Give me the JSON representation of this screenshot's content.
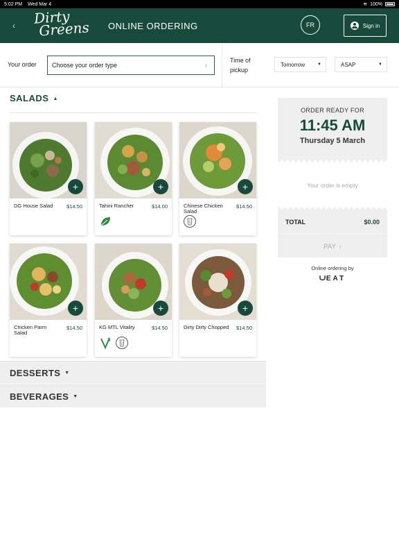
{
  "status": {
    "time": "5:02 PM",
    "date": "Wed Mar 4",
    "battery": "100%"
  },
  "header": {
    "logo_line1": "Dirty",
    "logo_line2": "Greens",
    "title": "ONLINE ORDERING",
    "lang": "FR",
    "signin": "Sign in"
  },
  "order": {
    "your_order_label": "Your order",
    "order_type_placeholder": "Choose your order type",
    "time_label": "Time of pickup",
    "day": "Tomorrow",
    "time": "ASAP"
  },
  "menu": {
    "salads_title": "SALADS",
    "items": [
      {
        "name": "DG House Salad",
        "price": "$14.50"
      },
      {
        "name": "Tahini Rancher",
        "price": "$14.00"
      },
      {
        "name": "Chinese Chicken Salad",
        "price": "$14.50"
      },
      {
        "name": "Chicken Parm Salad",
        "price": "$14.50"
      },
      {
        "name": "KG MTL Vitality",
        "price": "$14.50"
      },
      {
        "name": "Dirty Dirty Chopped",
        "price": "$14.50"
      }
    ],
    "desserts_title": "DESSERTS",
    "beverages_title": "BEVERAGES"
  },
  "cart": {
    "ready_label": "ORDER READY FOR",
    "ready_time": "11:45 AM",
    "ready_date": "Thursday 5 March",
    "empty_text": "Your order is empty",
    "total_label": "TOTAL",
    "total_value": "$0.00",
    "pay_label": "PAY",
    "byline": "Online ordering by",
    "brand": "EAT"
  },
  "colors": {
    "brand_green": "#174a3a",
    "panel_gray": "#efefef"
  },
  "icons": [
    "back-chevron-icon",
    "user-icon",
    "caret-down-icon",
    "plus-icon",
    "leaf-icon",
    "vegan-icon",
    "takeout-cup-icon",
    "chevron-right-icon",
    "wifi-icon",
    "battery-icon"
  ]
}
